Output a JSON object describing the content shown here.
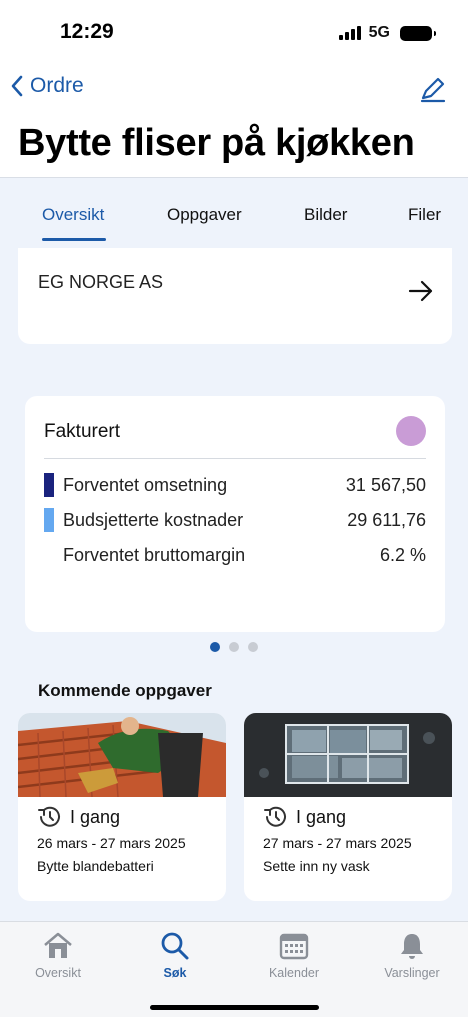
{
  "status_bar": {
    "time": "12:29",
    "network": "5G"
  },
  "nav": {
    "back_label": "Ordre"
  },
  "page": {
    "title": "Bytte fliser på kjøkken"
  },
  "tabs": [
    {
      "label": "Oversikt",
      "active": true
    },
    {
      "label": "Oppgaver",
      "active": false
    },
    {
      "label": "Bilder",
      "active": false
    },
    {
      "label": "Filer",
      "active": false
    }
  ],
  "company": {
    "name": "EG NORGE AS"
  },
  "finance": {
    "title": "Fakturert",
    "status_color": "#c99cd6",
    "rows": [
      {
        "label": "Forventet omsetning",
        "value": "31 567,50",
        "color": "#1a237e"
      },
      {
        "label": "Budsjetterte kostnader",
        "value": "29 611,76",
        "color": "#64a8f0"
      },
      {
        "label": "Forventet bruttomargin",
        "value": "6.2 %",
        "color": ""
      }
    ]
  },
  "pager": {
    "count": 3,
    "active": 0
  },
  "upcoming": {
    "title": "Kommende oppgaver",
    "tasks": [
      {
        "status": "I gang",
        "date": "26 mars - 27 mars 2025",
        "description": "Bytte blandebatteri"
      },
      {
        "status": "I gang",
        "date": "27 mars - 27 mars 2025",
        "description": "Sette inn ny vask"
      }
    ]
  },
  "bottom_nav": [
    {
      "label": "Oversikt",
      "icon": "home-icon",
      "active": false
    },
    {
      "label": "Søk",
      "icon": "search-icon",
      "active": true
    },
    {
      "label": "Kalender",
      "icon": "calendar-icon",
      "active": false
    },
    {
      "label": "Varslinger",
      "icon": "bell-icon",
      "active": false
    }
  ],
  "colors": {
    "accent": "#1c5aa8",
    "background": "#eef3fb"
  }
}
